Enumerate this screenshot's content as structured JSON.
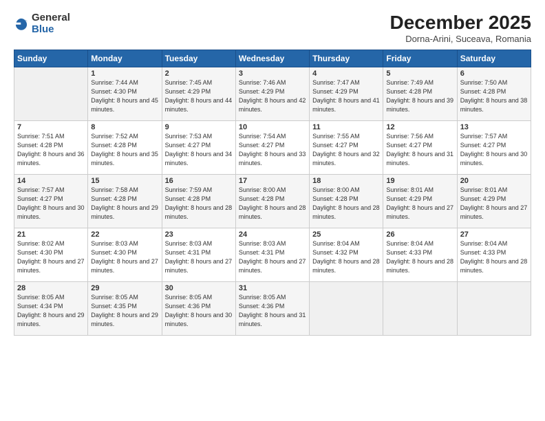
{
  "logo": {
    "general": "General",
    "blue": "Blue"
  },
  "title": "December 2025",
  "location": "Dorna-Arini, Suceava, Romania",
  "days_of_week": [
    "Sunday",
    "Monday",
    "Tuesday",
    "Wednesday",
    "Thursday",
    "Friday",
    "Saturday"
  ],
  "weeks": [
    [
      {
        "num": "",
        "sunrise": "",
        "sunset": "",
        "daylight": ""
      },
      {
        "num": "1",
        "sunrise": "Sunrise: 7:44 AM",
        "sunset": "Sunset: 4:30 PM",
        "daylight": "Daylight: 8 hours and 45 minutes."
      },
      {
        "num": "2",
        "sunrise": "Sunrise: 7:45 AM",
        "sunset": "Sunset: 4:29 PM",
        "daylight": "Daylight: 8 hours and 44 minutes."
      },
      {
        "num": "3",
        "sunrise": "Sunrise: 7:46 AM",
        "sunset": "Sunset: 4:29 PM",
        "daylight": "Daylight: 8 hours and 42 minutes."
      },
      {
        "num": "4",
        "sunrise": "Sunrise: 7:47 AM",
        "sunset": "Sunset: 4:29 PM",
        "daylight": "Daylight: 8 hours and 41 minutes."
      },
      {
        "num": "5",
        "sunrise": "Sunrise: 7:49 AM",
        "sunset": "Sunset: 4:28 PM",
        "daylight": "Daylight: 8 hours and 39 minutes."
      },
      {
        "num": "6",
        "sunrise": "Sunrise: 7:50 AM",
        "sunset": "Sunset: 4:28 PM",
        "daylight": "Daylight: 8 hours and 38 minutes."
      }
    ],
    [
      {
        "num": "7",
        "sunrise": "Sunrise: 7:51 AM",
        "sunset": "Sunset: 4:28 PM",
        "daylight": "Daylight: 8 hours and 36 minutes."
      },
      {
        "num": "8",
        "sunrise": "Sunrise: 7:52 AM",
        "sunset": "Sunset: 4:28 PM",
        "daylight": "Daylight: 8 hours and 35 minutes."
      },
      {
        "num": "9",
        "sunrise": "Sunrise: 7:53 AM",
        "sunset": "Sunset: 4:27 PM",
        "daylight": "Daylight: 8 hours and 34 minutes."
      },
      {
        "num": "10",
        "sunrise": "Sunrise: 7:54 AM",
        "sunset": "Sunset: 4:27 PM",
        "daylight": "Daylight: 8 hours and 33 minutes."
      },
      {
        "num": "11",
        "sunrise": "Sunrise: 7:55 AM",
        "sunset": "Sunset: 4:27 PM",
        "daylight": "Daylight: 8 hours and 32 minutes."
      },
      {
        "num": "12",
        "sunrise": "Sunrise: 7:56 AM",
        "sunset": "Sunset: 4:27 PM",
        "daylight": "Daylight: 8 hours and 31 minutes."
      },
      {
        "num": "13",
        "sunrise": "Sunrise: 7:57 AM",
        "sunset": "Sunset: 4:27 PM",
        "daylight": "Daylight: 8 hours and 30 minutes."
      }
    ],
    [
      {
        "num": "14",
        "sunrise": "Sunrise: 7:57 AM",
        "sunset": "Sunset: 4:27 PM",
        "daylight": "Daylight: 8 hours and 30 minutes."
      },
      {
        "num": "15",
        "sunrise": "Sunrise: 7:58 AM",
        "sunset": "Sunset: 4:28 PM",
        "daylight": "Daylight: 8 hours and 29 minutes."
      },
      {
        "num": "16",
        "sunrise": "Sunrise: 7:59 AM",
        "sunset": "Sunset: 4:28 PM",
        "daylight": "Daylight: 8 hours and 28 minutes."
      },
      {
        "num": "17",
        "sunrise": "Sunrise: 8:00 AM",
        "sunset": "Sunset: 4:28 PM",
        "daylight": "Daylight: 8 hours and 28 minutes."
      },
      {
        "num": "18",
        "sunrise": "Sunrise: 8:00 AM",
        "sunset": "Sunset: 4:28 PM",
        "daylight": "Daylight: 8 hours and 28 minutes."
      },
      {
        "num": "19",
        "sunrise": "Sunrise: 8:01 AM",
        "sunset": "Sunset: 4:29 PM",
        "daylight": "Daylight: 8 hours and 27 minutes."
      },
      {
        "num": "20",
        "sunrise": "Sunrise: 8:01 AM",
        "sunset": "Sunset: 4:29 PM",
        "daylight": "Daylight: 8 hours and 27 minutes."
      }
    ],
    [
      {
        "num": "21",
        "sunrise": "Sunrise: 8:02 AM",
        "sunset": "Sunset: 4:30 PM",
        "daylight": "Daylight: 8 hours and 27 minutes."
      },
      {
        "num": "22",
        "sunrise": "Sunrise: 8:03 AM",
        "sunset": "Sunset: 4:30 PM",
        "daylight": "Daylight: 8 hours and 27 minutes."
      },
      {
        "num": "23",
        "sunrise": "Sunrise: 8:03 AM",
        "sunset": "Sunset: 4:31 PM",
        "daylight": "Daylight: 8 hours and 27 minutes."
      },
      {
        "num": "24",
        "sunrise": "Sunrise: 8:03 AM",
        "sunset": "Sunset: 4:31 PM",
        "daylight": "Daylight: 8 hours and 27 minutes."
      },
      {
        "num": "25",
        "sunrise": "Sunrise: 8:04 AM",
        "sunset": "Sunset: 4:32 PM",
        "daylight": "Daylight: 8 hours and 28 minutes."
      },
      {
        "num": "26",
        "sunrise": "Sunrise: 8:04 AM",
        "sunset": "Sunset: 4:33 PM",
        "daylight": "Daylight: 8 hours and 28 minutes."
      },
      {
        "num": "27",
        "sunrise": "Sunrise: 8:04 AM",
        "sunset": "Sunset: 4:33 PM",
        "daylight": "Daylight: 8 hours and 28 minutes."
      }
    ],
    [
      {
        "num": "28",
        "sunrise": "Sunrise: 8:05 AM",
        "sunset": "Sunset: 4:34 PM",
        "daylight": "Daylight: 8 hours and 29 minutes."
      },
      {
        "num": "29",
        "sunrise": "Sunrise: 8:05 AM",
        "sunset": "Sunset: 4:35 PM",
        "daylight": "Daylight: 8 hours and 29 minutes."
      },
      {
        "num": "30",
        "sunrise": "Sunrise: 8:05 AM",
        "sunset": "Sunset: 4:36 PM",
        "daylight": "Daylight: 8 hours and 30 minutes."
      },
      {
        "num": "31",
        "sunrise": "Sunrise: 8:05 AM",
        "sunset": "Sunset: 4:36 PM",
        "daylight": "Daylight: 8 hours and 31 minutes."
      },
      {
        "num": "",
        "sunrise": "",
        "sunset": "",
        "daylight": ""
      },
      {
        "num": "",
        "sunrise": "",
        "sunset": "",
        "daylight": ""
      },
      {
        "num": "",
        "sunrise": "",
        "sunset": "",
        "daylight": ""
      }
    ]
  ]
}
